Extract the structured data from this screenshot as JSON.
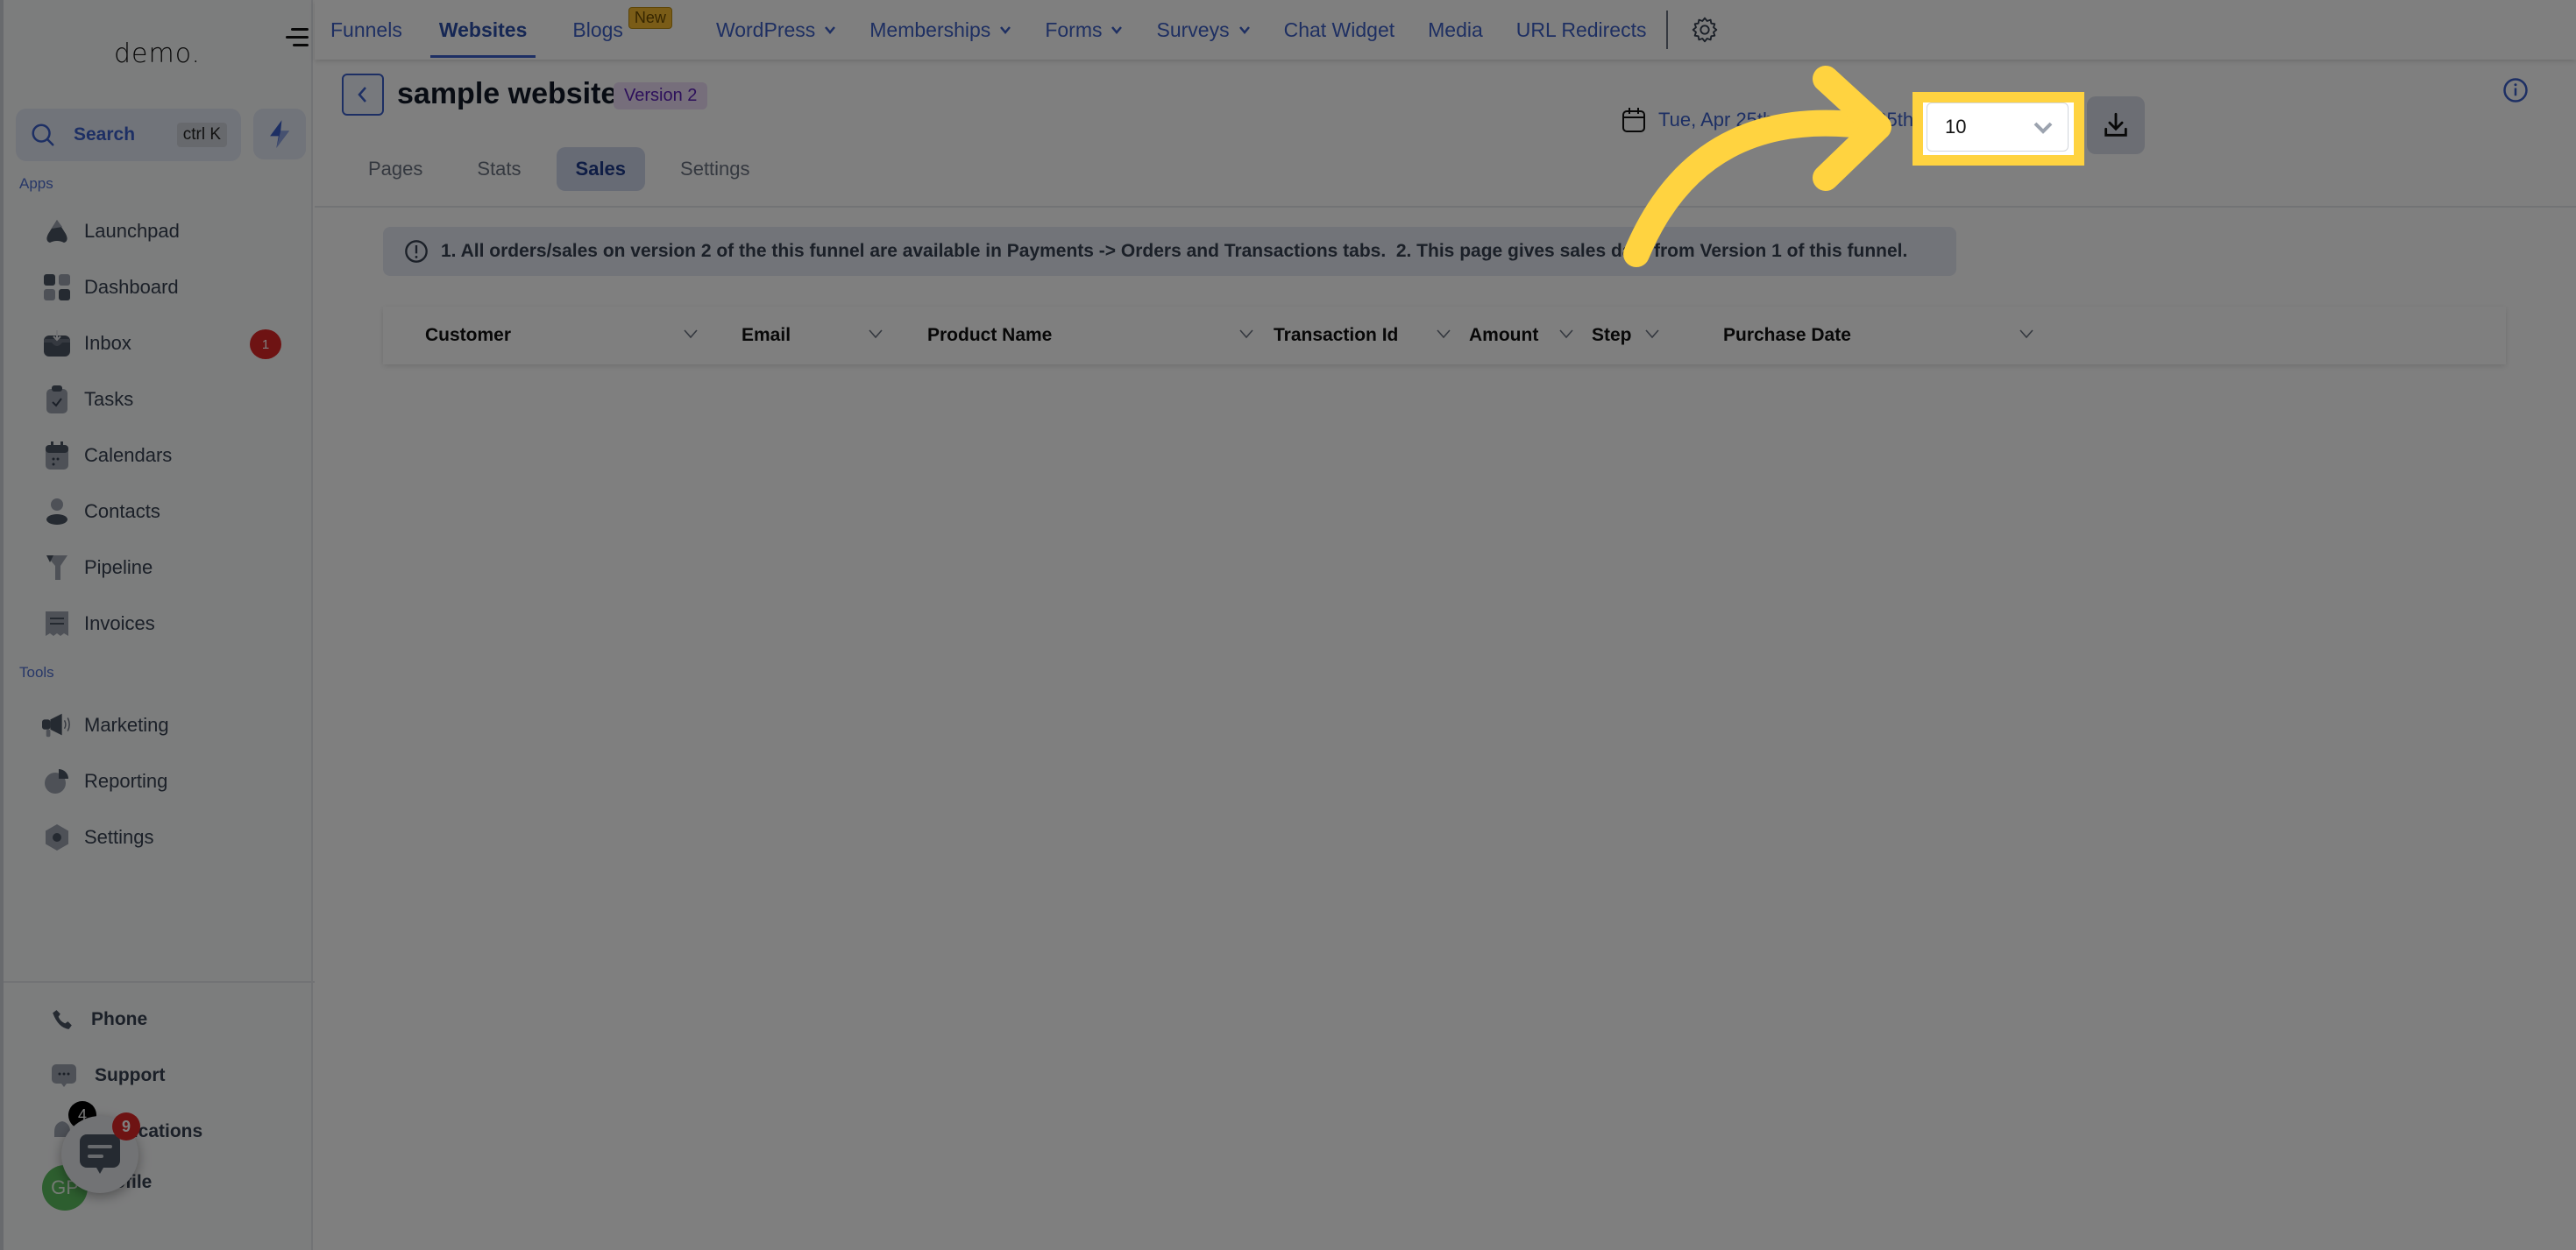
{
  "sidebar": {
    "logo": "demo.",
    "search": {
      "label": "Search",
      "shortcut": "ctrl K"
    },
    "sections": {
      "apps": "Apps",
      "tools": "Tools"
    },
    "apps": [
      {
        "label": "Launchpad",
        "icon": "rocket-icon"
      },
      {
        "label": "Dashboard",
        "icon": "grid-icon"
      },
      {
        "label": "Inbox",
        "icon": "inbox-icon",
        "badge": "1"
      },
      {
        "label": "Tasks",
        "icon": "clipboard-check-icon"
      },
      {
        "label": "Calendars",
        "icon": "calendar-icon"
      },
      {
        "label": "Contacts",
        "icon": "user-icon"
      },
      {
        "label": "Pipeline",
        "icon": "funnel-icon"
      },
      {
        "label": "Invoices",
        "icon": "receipt-icon"
      }
    ],
    "tools": [
      {
        "label": "Marketing",
        "icon": "megaphone-icon"
      },
      {
        "label": "Reporting",
        "icon": "pie-chart-icon"
      },
      {
        "label": "Settings",
        "icon": "settings-hex-icon"
      }
    ],
    "bottom": [
      {
        "label": "Phone",
        "icon": "phone-icon"
      },
      {
        "label": "Support",
        "icon": "chat-bubble-icon"
      },
      {
        "label": "Notifications",
        "icon": "bell-icon",
        "badge": "4"
      },
      {
        "label": "Profile",
        "avatar": "GP"
      }
    ],
    "chat_widget_badge": "9"
  },
  "topnav": {
    "items": [
      {
        "label": "Funnels"
      },
      {
        "label": "Websites",
        "active": true
      },
      {
        "label": "Blogs",
        "badge": "New"
      },
      {
        "label": "WordPress",
        "dropdown": true
      },
      {
        "label": "Memberships",
        "dropdown": true
      },
      {
        "label": "Forms",
        "dropdown": true
      },
      {
        "label": "Surveys",
        "dropdown": true
      },
      {
        "label": "Chat Widget"
      },
      {
        "label": "Media"
      },
      {
        "label": "URL Redirects"
      }
    ]
  },
  "page": {
    "title": "sample website",
    "version": "Version 2",
    "tabs": [
      "Pages",
      "Stats",
      "Sales",
      "Settings"
    ],
    "active_tab": "Sales",
    "date_range": "Tue, Apr 25th - Thu, May 25th",
    "page_size": "10"
  },
  "alert": {
    "text": "1. All orders/sales on version 2 of the this funnel are available in Payments -> Orders and Transactions tabs.  2. This page gives sales data from Version 1 of this funnel."
  },
  "table": {
    "columns": [
      "Customer",
      "Email",
      "Product Name",
      "Transaction Id",
      "Amount",
      "Step",
      "Purchase Date"
    ],
    "rows": []
  },
  "colors": {
    "accent": "#3b5fc9",
    "highlight": "#ffd340",
    "badge_red": "#dc2626"
  }
}
